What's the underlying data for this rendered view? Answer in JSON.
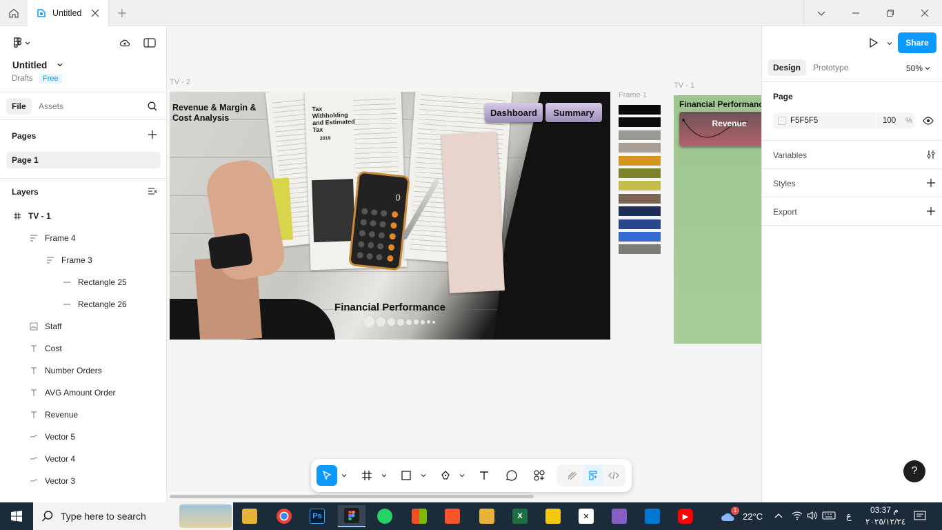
{
  "tabbar": {
    "tab_title": "Untitled"
  },
  "left_panel": {
    "file_title": "Untitled",
    "drafts_label": "Drafts",
    "plan_badge": "Free",
    "tabs": {
      "file": "File",
      "assets": "Assets"
    },
    "pages_label": "Pages",
    "pages": [
      "Page 1"
    ],
    "layers_label": "Layers",
    "layers": [
      {
        "name": "TV - 1",
        "icon": "frame-icon",
        "depth": 0
      },
      {
        "name": "Frame 4",
        "icon": "auto-layout-icon",
        "depth": 1
      },
      {
        "name": "Frame 3",
        "icon": "auto-layout-icon",
        "depth": 2
      },
      {
        "name": "Rectangle 25",
        "icon": "rectangle-icon",
        "depth": 3
      },
      {
        "name": "Rectangle 26",
        "icon": "rectangle-icon",
        "depth": 3
      },
      {
        "name": "Staff",
        "icon": "image-icon",
        "depth": 1
      },
      {
        "name": "Cost",
        "icon": "text-icon",
        "depth": 1
      },
      {
        "name": "Number Orders",
        "icon": "text-icon",
        "depth": 1
      },
      {
        "name": "AVG Amount Order",
        "icon": "text-icon",
        "depth": 1
      },
      {
        "name": "Revenue",
        "icon": "text-icon",
        "depth": 1
      },
      {
        "name": "Vector 5",
        "icon": "vector-icon",
        "depth": 1
      },
      {
        "name": "Vector 4",
        "icon": "vector-icon",
        "depth": 1
      },
      {
        "name": "Vector 3",
        "icon": "vector-icon",
        "depth": 1
      }
    ]
  },
  "canvas": {
    "tv2": {
      "label": "TV - 2",
      "title": "Revenue & Margin & Cost Analysis",
      "buttons": [
        "Dashboard",
        "Summary"
      ],
      "footer_title": "Financial Performance",
      "doc_text": [
        "Tax",
        "Withholding",
        "and Estimated",
        "Tax",
        "2019"
      ],
      "calc_display": "0"
    },
    "frame1": {
      "label": "Frame 1",
      "swatches": [
        "#0a0a0a",
        "#0d0d0d",
        "#9a9a92",
        "#a89e95",
        "#d4961e",
        "#7d832b",
        "#c4bd4e",
        "#7d6452",
        "#1f2d5a",
        "#26478c",
        "#3468d2",
        "#7c7b76"
      ]
    },
    "tv1": {
      "label": "TV - 1",
      "title": "Financial Performance",
      "card_label": "Revenue"
    }
  },
  "right_panel": {
    "share_label": "Share",
    "tabs": {
      "design": "Design",
      "prototype": "Prototype"
    },
    "zoom": "50%",
    "page_section": "Page",
    "page_color_hex": "F5F5F5",
    "page_opacity": "100",
    "page_opacity_unit": "%",
    "sections": [
      "Variables",
      "Styles",
      "Export"
    ],
    "help": "?"
  },
  "taskbar": {
    "search_placeholder": "Type here to search",
    "weather_badge": "1",
    "temperature": "22°C",
    "lang": "ع",
    "time": "03:37 م",
    "date": "٢٠٢٥/١٢/٢٤"
  },
  "colors": {
    "accent": "#0d99ff",
    "canvas_bg": "#f5f5f5",
    "taskbar": "#1c2b3a"
  }
}
